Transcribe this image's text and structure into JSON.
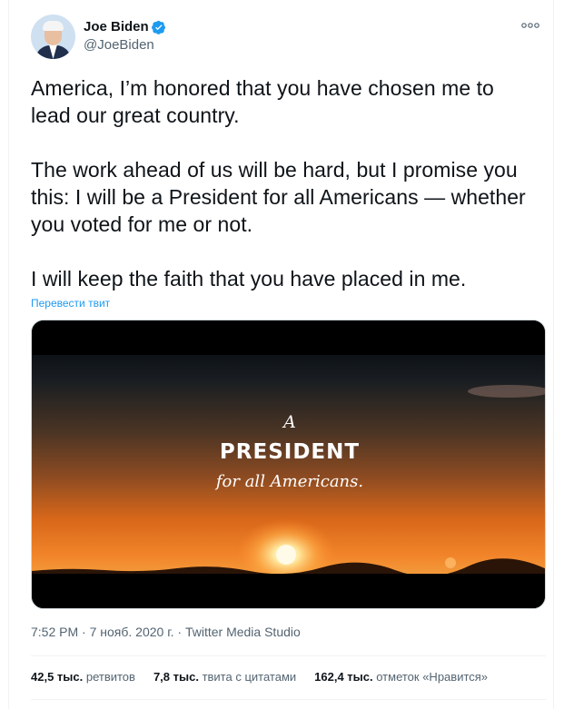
{
  "author": {
    "name": "Joe Biden",
    "handle": "@JoeBiden",
    "verified": true,
    "verified_color": "#1d9bf0"
  },
  "menu_icon": "more-dots-icon",
  "tweet": {
    "paragraphs": [
      "America, I’m honored that you have chosen me to lead our great country.",
      "The work ahead of us will be hard, but I promise you this: I will be a President for all Americans — whether you voted for me or not.",
      "I will keep the faith that you have placed in me."
    ],
    "translate_label": "Перевести твит"
  },
  "media": {
    "line1": "A",
    "line2": "PRESIDENT",
    "line3": "for all Americans."
  },
  "meta": {
    "time": "7:52 PM",
    "date": "7 нояб. 2020 г.",
    "source": "Twitter Media Studio"
  },
  "stats": [
    {
      "count": "42,5 тыс.",
      "label": "ретвитов"
    },
    {
      "count": "7,8 тыс.",
      "label": "твита с цитатами"
    },
    {
      "count": "162,4 тыс.",
      "label": "отметок «Нравится»"
    }
  ]
}
